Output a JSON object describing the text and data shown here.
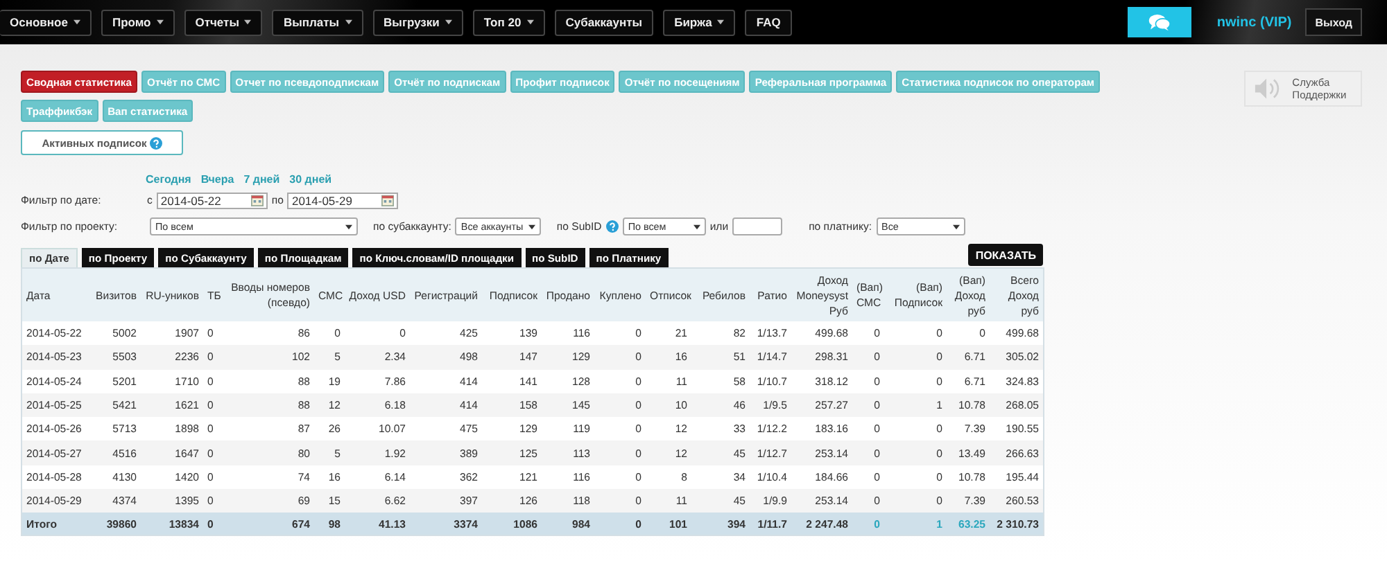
{
  "nav": {
    "items": [
      {
        "label": "Основное",
        "dropdown": true
      },
      {
        "label": "Промо",
        "dropdown": true
      },
      {
        "label": "Отчеты",
        "dropdown": true
      },
      {
        "label": "Выплаты",
        "dropdown": true
      },
      {
        "label": "Выгрузки",
        "dropdown": true
      },
      {
        "label": "Топ 20",
        "dropdown": true
      },
      {
        "label": "Субаккаунты",
        "dropdown": false
      },
      {
        "label": "Биржа",
        "dropdown": true
      },
      {
        "label": "FAQ",
        "dropdown": false
      }
    ],
    "user": "nwinc (VIP)",
    "logout": "Выход"
  },
  "report_buttons": [
    {
      "label": "Сводная статистика",
      "selected": true
    },
    {
      "label": "Отчёт по СМС",
      "selected": false
    },
    {
      "label": "Отчет по псевдоподпискам",
      "selected": false
    },
    {
      "label": "Отчёт по подпискам",
      "selected": false
    },
    {
      "label": "Профит подписок",
      "selected": false
    },
    {
      "label": "Отчёт по посещениям",
      "selected": false
    },
    {
      "label": "Реферальная программа",
      "selected": false
    },
    {
      "label": "Статистика подписок по операторам",
      "selected": false
    },
    {
      "label": "Траффикбэк",
      "selected": false
    },
    {
      "label": "Вап статистика",
      "selected": false
    }
  ],
  "active_subscriptions": "Активных подписок",
  "support": "Служба Поддержки",
  "quick_dates": [
    "Сегодня",
    "Вчера",
    "7 дней",
    "30 дней"
  ],
  "filters": {
    "date_label": "Фильтр по дате:",
    "from_prefix": "с",
    "from": "2014-05-22",
    "to_prefix": "по",
    "to": "2014-05-29",
    "project_label": "Фильтр по проекту:",
    "project": "По всем",
    "subaccount_label": "по субаккаунту:",
    "subaccount": "Все аккаунты",
    "subid_label": "по SubID",
    "subid": "По всем",
    "or_label": "или",
    "payer_label": "по платнику:",
    "payer": "Все"
  },
  "view_tabs": [
    {
      "label": "по Дате",
      "selected": true
    },
    {
      "label": "по Проекту",
      "selected": false
    },
    {
      "label": "по Субаккаунту",
      "selected": false
    },
    {
      "label": "по Площадкам",
      "selected": false
    },
    {
      "label": "по Ключ.словам/ID площадки",
      "selected": false
    },
    {
      "label": "по SubID",
      "selected": false
    },
    {
      "label": "по Платнику",
      "selected": false
    }
  ],
  "show_button": "ПОКАЗАТЬ",
  "table": {
    "columns": [
      "Дата",
      "Визитов",
      "RU-уников",
      "ТБ",
      "Вводы номеров\n(псевдо)",
      "СМС",
      "Доход USD",
      "Регистраций",
      "Подписок",
      "Продано",
      "Куплено",
      "Отписок",
      "Ребилов",
      "Ратио",
      "Доход\nMoneysyst\nРуб",
      "(Вап)\nСМС",
      "(Вап)\nПодписок",
      "(Вап)\nДоход\nруб",
      "Всего\nДоход\nруб"
    ],
    "rows": [
      [
        "2014-05-22",
        "5002",
        "1907",
        "0",
        "86",
        "0",
        "0",
        "425",
        "139",
        "116",
        "0",
        "21",
        "82",
        "1/13.7",
        "499.68",
        "0",
        "0",
        "0",
        "499.68"
      ],
      [
        "2014-05-23",
        "5503",
        "2236",
        "0",
        "102",
        "5",
        "2.34",
        "498",
        "147",
        "129",
        "0",
        "16",
        "51",
        "1/14.7",
        "298.31",
        "0",
        "0",
        "6.71",
        "305.02"
      ],
      [
        "2014-05-24",
        "5201",
        "1710",
        "0",
        "88",
        "19",
        "7.86",
        "414",
        "141",
        "128",
        "0",
        "11",
        "58",
        "1/10.7",
        "318.12",
        "0",
        "0",
        "6.71",
        "324.83"
      ],
      [
        "2014-05-25",
        "5421",
        "1621",
        "0",
        "88",
        "12",
        "6.18",
        "414",
        "158",
        "145",
        "0",
        "10",
        "46",
        "1/9.5",
        "257.27",
        "0",
        "1",
        "10.78",
        "268.05"
      ],
      [
        "2014-05-26",
        "5713",
        "1898",
        "0",
        "87",
        "26",
        "10.07",
        "475",
        "129",
        "119",
        "0",
        "12",
        "33",
        "1/12.2",
        "183.16",
        "0",
        "0",
        "7.39",
        "190.55"
      ],
      [
        "2014-05-27",
        "4516",
        "1647",
        "0",
        "80",
        "5",
        "1.92",
        "389",
        "125",
        "113",
        "0",
        "12",
        "45",
        "1/12.7",
        "253.14",
        "0",
        "0",
        "13.49",
        "266.63"
      ],
      [
        "2014-05-28",
        "4130",
        "1420",
        "0",
        "74",
        "16",
        "6.14",
        "362",
        "121",
        "116",
        "0",
        "8",
        "34",
        "1/10.4",
        "184.66",
        "0",
        "0",
        "10.78",
        "195.44"
      ],
      [
        "2014-05-29",
        "4374",
        "1395",
        "0",
        "69",
        "15",
        "6.62",
        "397",
        "126",
        "118",
        "0",
        "11",
        "45",
        "1/9.9",
        "253.14",
        "0",
        "0",
        "7.39",
        "260.53"
      ]
    ],
    "total": [
      {
        "text": "Итого",
        "link": false
      },
      {
        "text": "39860",
        "link": false
      },
      {
        "text": "13834",
        "link": false
      },
      {
        "text": "0",
        "link": false
      },
      {
        "text": "674",
        "link": false
      },
      {
        "text": "98",
        "link": false
      },
      {
        "text": "41.13",
        "link": false
      },
      {
        "text": "3374",
        "link": false
      },
      {
        "text": "1086",
        "link": false
      },
      {
        "text": "984",
        "link": false
      },
      {
        "text": "0",
        "link": false
      },
      {
        "text": "101",
        "link": false
      },
      {
        "text": "394",
        "link": false
      },
      {
        "text": "1/11.7",
        "link": false
      },
      {
        "text": "2 247.48",
        "link": false
      },
      {
        "text": "0",
        "link": true
      },
      {
        "text": "1",
        "link": true
      },
      {
        "text": "63.25",
        "link": true
      },
      {
        "text": "2 310.73",
        "link": false
      }
    ]
  }
}
